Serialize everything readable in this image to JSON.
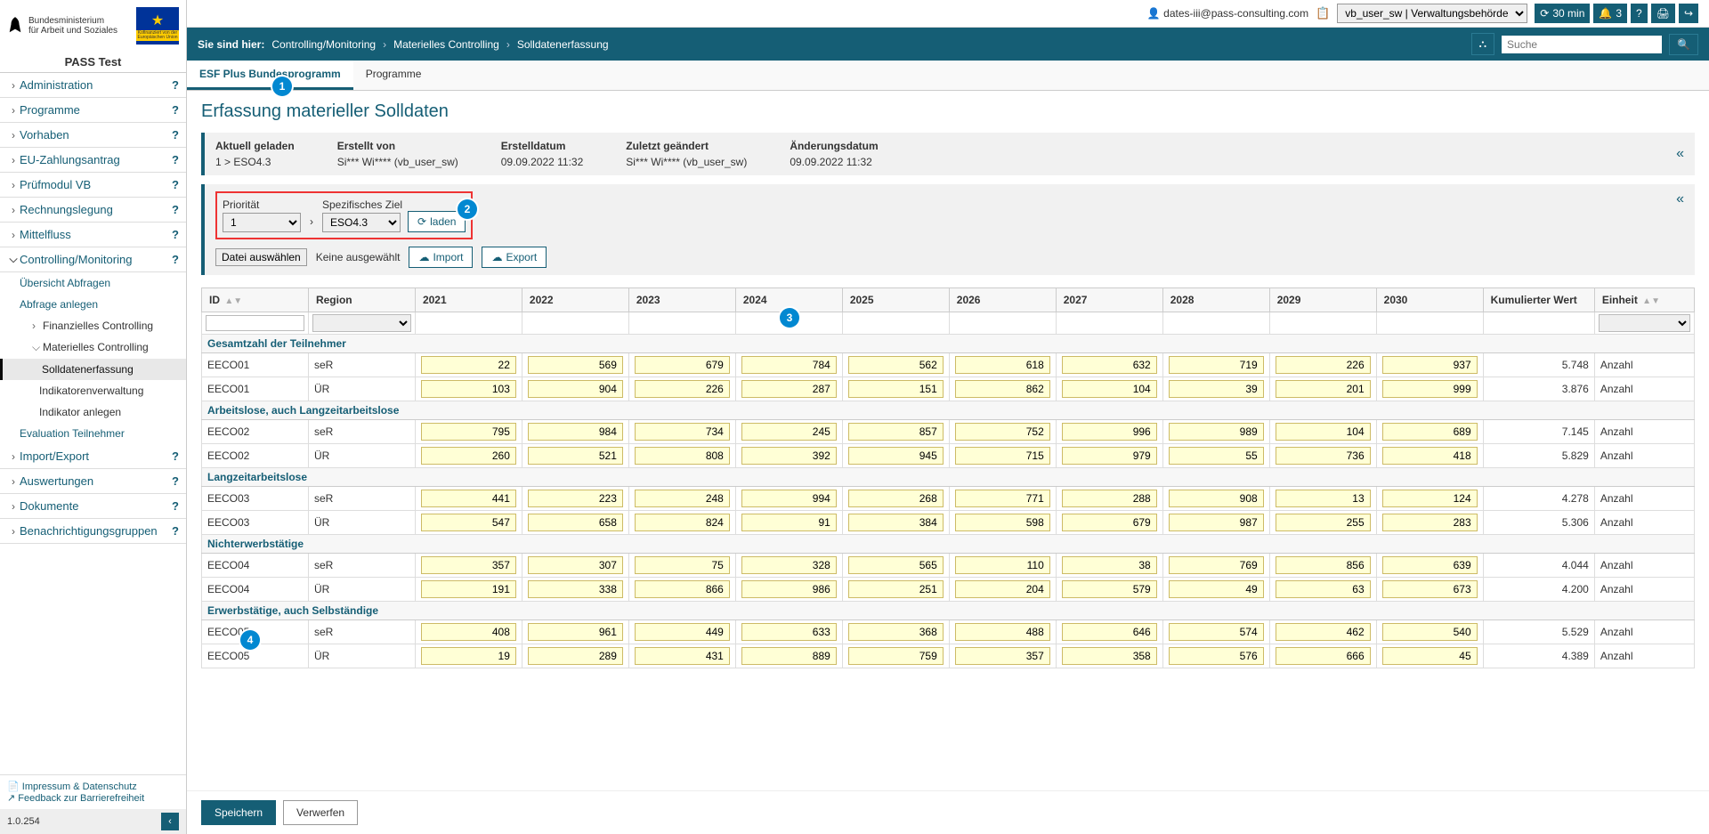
{
  "sidebar": {
    "ministry_line1": "Bundesministerium",
    "ministry_line2": "für Arbeit und Soziales",
    "eu_caption_line1": "Kofinanziert von der",
    "eu_caption_line2": "Europäischen Union",
    "app_title": "PASS Test",
    "nav": [
      {
        "label": "Administration"
      },
      {
        "label": "Programme"
      },
      {
        "label": "Vorhaben"
      },
      {
        "label": "EU-Zahlungsantrag"
      },
      {
        "label": "Prüfmodul VB"
      },
      {
        "label": "Rechnungslegung"
      },
      {
        "label": "Mittelfluss"
      }
    ],
    "nav_open": {
      "label": "Controlling/Monitoring"
    },
    "nav_sub": {
      "uebersicht": "Übersicht Abfragen",
      "abfrage_anlegen": "Abfrage anlegen",
      "fin_controlling": "Finanzielles Controlling",
      "mat_controlling": "Materielles Controlling",
      "solldaten": "Solldatenerfassung",
      "indikatorenverwaltung": "Indikatorenverwaltung",
      "indikator_anlegen": "Indikator anlegen",
      "evaluation": "Evaluation Teilnehmer"
    },
    "nav_after": [
      {
        "label": "Import/Export"
      },
      {
        "label": "Auswertungen"
      },
      {
        "label": "Dokumente"
      },
      {
        "label": "Benachrichtigungsgruppen"
      }
    ],
    "footer": {
      "impressum": "Impressum & Datenschutz",
      "feedback": "Feedback zur Barrierefreiheit",
      "version": "1.0.254"
    }
  },
  "topbar": {
    "user_email": "dates-iii@pass-consulting.com",
    "role_select": "vb_user_sw | Verwaltungsbehörde",
    "timer": "30 min",
    "notif_count": "3"
  },
  "breadcrumb": {
    "label": "Sie sind hier:",
    "items": [
      "Controlling/Monitoring",
      "Materielles Controlling",
      "Solldatenerfassung"
    ],
    "search_placeholder": "Suche"
  },
  "tabs": {
    "t0": "ESF Plus Bundesprogramm",
    "t1": "Programme"
  },
  "page": {
    "title": "Erfassung materieller Solldaten"
  },
  "info": {
    "labels": {
      "aktuell": "Aktuell geladen",
      "erstellt_von": "Erstellt von",
      "erstelldatum": "Erstelldatum",
      "zuletzt": "Zuletzt geändert",
      "aenderungsdatum": "Änderungsdatum"
    },
    "values": {
      "aktuell": "1 > ESO4.3",
      "erstellt_von": "Si*** Wi**** (vb_user_sw)",
      "erstelldatum": "09.09.2022 11:32",
      "zuletzt": "Si*** Wi**** (vb_user_sw)",
      "aenderungsdatum": "09.09.2022 11:32"
    }
  },
  "controls": {
    "prioritaet_label": "Priorität",
    "prioritaet_value": "1",
    "ziel_label": "Spezifisches Ziel",
    "ziel_value": "ESO4.3",
    "laden": "laden",
    "file_btn": "Datei auswählen",
    "file_status": "Keine ausgewählt",
    "import": "Import",
    "export": "Export"
  },
  "table": {
    "headers": {
      "id": "ID",
      "region": "Region",
      "y2021": "2021",
      "y2022": "2022",
      "y2023": "2023",
      "y2024": "2024",
      "y2025": "2025",
      "y2026": "2026",
      "y2027": "2027",
      "y2028": "2028",
      "y2029": "2029",
      "y2030": "2030",
      "kumuliert": "Kumulierter Wert",
      "einheit": "Einheit"
    },
    "groups": [
      {
        "title": "Gesamtzahl der Teilnehmer",
        "rows": [
          {
            "id": "EECO01",
            "region": "seR",
            "v": [
              "22",
              "569",
              "679",
              "784",
              "562",
              "618",
              "632",
              "719",
              "226",
              "937"
            ],
            "kum": "5.748",
            "unit": "Anzahl"
          },
          {
            "id": "EECO01",
            "region": "ÜR",
            "v": [
              "103",
              "904",
              "226",
              "287",
              "151",
              "862",
              "104",
              "39",
              "201",
              "999"
            ],
            "kum": "3.876",
            "unit": "Anzahl"
          }
        ]
      },
      {
        "title": "Arbeitslose, auch Langzeitarbeitslose",
        "rows": [
          {
            "id": "EECO02",
            "region": "seR",
            "v": [
              "795",
              "984",
              "734",
              "245",
              "857",
              "752",
              "996",
              "989",
              "104",
              "689"
            ],
            "kum": "7.145",
            "unit": "Anzahl"
          },
          {
            "id": "EECO02",
            "region": "ÜR",
            "v": [
              "260",
              "521",
              "808",
              "392",
              "945",
              "715",
              "979",
              "55",
              "736",
              "418"
            ],
            "kum": "5.829",
            "unit": "Anzahl"
          }
        ]
      },
      {
        "title": "Langzeitarbeitslose",
        "rows": [
          {
            "id": "EECO03",
            "region": "seR",
            "v": [
              "441",
              "223",
              "248",
              "994",
              "268",
              "771",
              "288",
              "908",
              "13",
              "124"
            ],
            "kum": "4.278",
            "unit": "Anzahl"
          },
          {
            "id": "EECO03",
            "region": "ÜR",
            "v": [
              "547",
              "658",
              "824",
              "91",
              "384",
              "598",
              "679",
              "987",
              "255",
              "283"
            ],
            "kum": "5.306",
            "unit": "Anzahl"
          }
        ]
      },
      {
        "title": "Nichterwerbstätige",
        "rows": [
          {
            "id": "EECO04",
            "region": "seR",
            "v": [
              "357",
              "307",
              "75",
              "328",
              "565",
              "110",
              "38",
              "769",
              "856",
              "639"
            ],
            "kum": "4.044",
            "unit": "Anzahl"
          },
          {
            "id": "EECO04",
            "region": "ÜR",
            "v": [
              "191",
              "338",
              "866",
              "986",
              "251",
              "204",
              "579",
              "49",
              "63",
              "673"
            ],
            "kum": "4.200",
            "unit": "Anzahl"
          }
        ]
      },
      {
        "title": "Erwerbstätige, auch Selbständige",
        "rows": [
          {
            "id": "EECO05",
            "region": "seR",
            "v": [
              "408",
              "961",
              "449",
              "633",
              "368",
              "488",
              "646",
              "574",
              "462",
              "540"
            ],
            "kum": "5.529",
            "unit": "Anzahl"
          },
          {
            "id": "EECO05",
            "region": "ÜR",
            "v": [
              "19",
              "289",
              "431",
              "889",
              "759",
              "357",
              "358",
              "576",
              "666",
              "45"
            ],
            "kum": "4.389",
            "unit": "Anzahl"
          }
        ]
      }
    ]
  },
  "actions": {
    "save": "Speichern",
    "discard": "Verwerfen"
  },
  "callouts": {
    "c1": "1",
    "c2": "2",
    "c3": "3",
    "c4": "4"
  }
}
